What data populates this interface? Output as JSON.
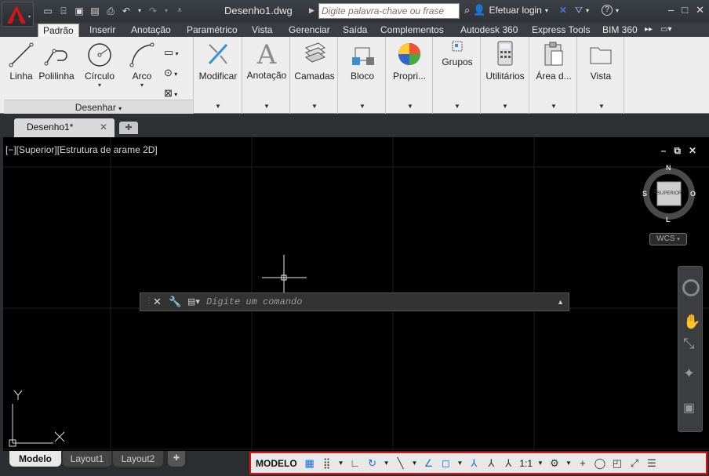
{
  "titlebar": {
    "doc_title": "Desenho1.dwg",
    "search_placeholder": "Digite palavra-chave ou frase",
    "login_label": "Efetuar login"
  },
  "ribbon_tabs": [
    "Padrão",
    "Inserir",
    "Anotação",
    "Paramétrico",
    "Vista",
    "Gerenciar",
    "Saída",
    "Complementos",
    "Autodesk 360",
    "Express Tools",
    "BIM 360"
  ],
  "ribbon": {
    "draw_tools": [
      "Linha",
      "Polilinha",
      "Círculo",
      "Arco"
    ],
    "draw_panel_title": "Desenhar",
    "panels": [
      "Modificar",
      "Anotação",
      "Camadas",
      "Bloco",
      "Propri...",
      "Grupos",
      "Utilitários",
      "Área d...",
      "Vista"
    ]
  },
  "doc_tabs": {
    "active": "Desenho1*"
  },
  "viewport": {
    "label": "[−][Superior][Estrutura de arame 2D]",
    "viewcube": {
      "face": "SUPERIOR",
      "n": "N",
      "s": "S",
      "l": "L",
      "o": "O"
    },
    "wcs": "WCS",
    "ucs_y": "Y"
  },
  "command": {
    "placeholder": "Digite um comando"
  },
  "layout_tabs": [
    "Modelo",
    "Layout1",
    "Layout2"
  ],
  "status": {
    "model": "MODELO",
    "scale": "1:1"
  }
}
